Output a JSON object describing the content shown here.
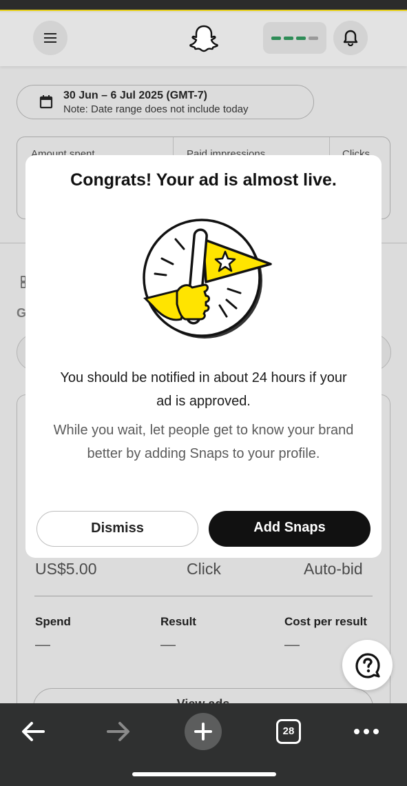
{
  "header": {
    "menu_icon": "hamburger-icon",
    "logo_icon": "snapchat-ghost-icon",
    "bell_icon": "bell-icon"
  },
  "date_range": {
    "title": "30 Jun – 6 Jul 2025 (GMT-7)",
    "note": "Note: Date range does not include today"
  },
  "metrics": {
    "labels": [
      "Amount spent",
      "Paid impressions",
      "Clicks"
    ]
  },
  "background": {
    "section_letter": "G",
    "bid_amount": "US$5.00",
    "goal": "Click",
    "bid_strategy": "Auto-bid",
    "stats": [
      {
        "label": "Spend",
        "value": "—"
      },
      {
        "label": "Result",
        "value": "—"
      },
      {
        "label": "Cost per result",
        "value": "—"
      }
    ],
    "view_ads_label": "View ads"
  },
  "modal": {
    "title": "Congrats! Your ad is almost live.",
    "message": "You should be notified in about 24 hours if your ad is approved.",
    "submessage": "While you wait, let people get to know your brand better by adding Snaps to your profile.",
    "dismiss_label": "Dismiss",
    "add_snaps_label": "Add Snaps"
  },
  "browser_nav": {
    "tab_count": "28"
  },
  "colors": {
    "accent_yellow": "#FFE400",
    "primary_button": "#111111",
    "status_green": "#2E8C57"
  }
}
